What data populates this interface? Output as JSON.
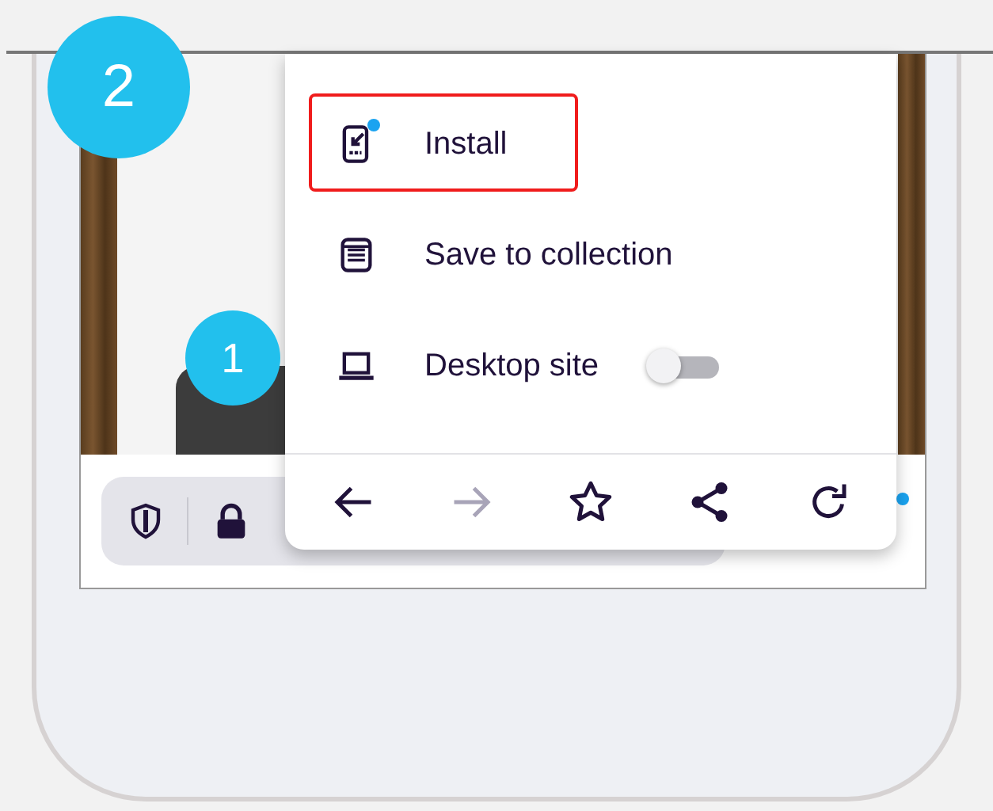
{
  "badges": [
    {
      "label": "2"
    },
    {
      "label": "1"
    }
  ],
  "menu": {
    "items": [
      {
        "kind": "install",
        "label": "Install",
        "highlighted": true,
        "notification": true
      },
      {
        "kind": "collection",
        "label": "Save to collection",
        "highlighted": false,
        "notification": false
      },
      {
        "kind": "desktop",
        "label": "Desktop site",
        "highlighted": false,
        "notification": false,
        "on": false
      }
    ],
    "nav": [
      {
        "kind": "back",
        "disabled": false
      },
      {
        "kind": "forward",
        "disabled": true
      },
      {
        "kind": "bookmark",
        "disabled": false
      },
      {
        "kind": "share",
        "disabled": false
      },
      {
        "kind": "reload",
        "disabled": false
      }
    ]
  },
  "toolbar": {
    "menu_notification": true
  }
}
